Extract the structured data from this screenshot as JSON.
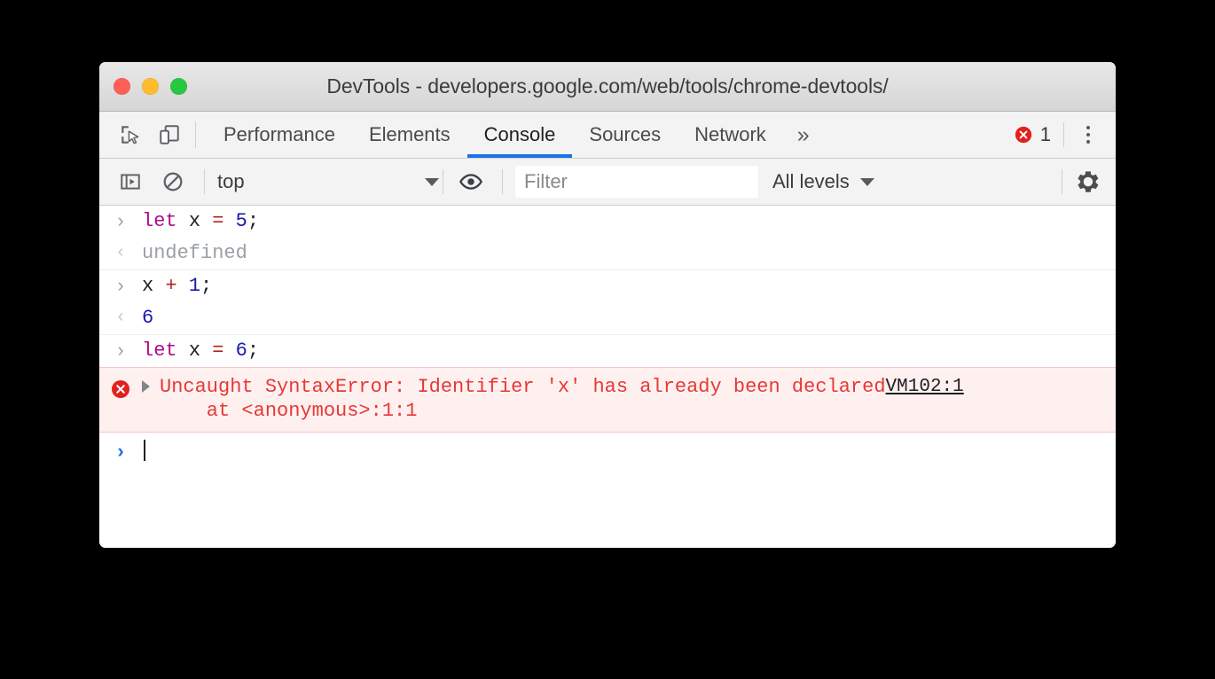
{
  "window": {
    "title": "DevTools - developers.google.com/web/tools/chrome-devtools/",
    "traffic_lights": [
      {
        "name": "close",
        "color": "#ff5f57"
      },
      {
        "name": "minimize",
        "color": "#febc2e"
      },
      {
        "name": "zoom",
        "color": "#28c840"
      }
    ]
  },
  "colors": {
    "accent": "#1a73e8",
    "error_red": "#e53935",
    "error_bg": "#fff0f0",
    "toolbar_bg": "#f3f3f3",
    "keyword": "#aa0d91",
    "number": "#1a1aa6",
    "operator": "#b22222"
  },
  "tabbar": {
    "icons": [
      {
        "name": "inspect-element-icon",
        "label": "Inspect element"
      },
      {
        "name": "device-toolbar-icon",
        "label": "Toggle device toolbar"
      }
    ],
    "tabs": [
      {
        "label": "Performance",
        "active": false
      },
      {
        "label": "Elements",
        "active": false
      },
      {
        "label": "Console",
        "active": true
      },
      {
        "label": "Sources",
        "active": false
      },
      {
        "label": "Network",
        "active": false
      }
    ],
    "overflow_label": "»",
    "error_badge": {
      "icon": "error-circle-icon",
      "count": "1"
    },
    "kebab_label": "Customize and control DevTools"
  },
  "filterbar": {
    "sidebar_toggle": {
      "name": "console-sidebar-icon",
      "label": "Show console sidebar"
    },
    "clear_console": {
      "name": "clear-console-icon",
      "label": "Clear console"
    },
    "context": {
      "value": "top",
      "caret": "▼"
    },
    "eye": {
      "name": "live-expression-icon",
      "label": "Create live expression"
    },
    "filter": {
      "value": "",
      "placeholder": "Filter"
    },
    "levels": {
      "value": "All levels",
      "caret": "▼"
    },
    "settings": {
      "name": "gear-icon",
      "label": "Console settings"
    }
  },
  "console": {
    "prompt_arrow": "›",
    "result_arrow": "‹",
    "entries": [
      {
        "type": "input",
        "tokens": [
          {
            "t": "kw",
            "v": "let"
          },
          {
            "t": "pun",
            "v": " "
          },
          {
            "t": "id",
            "v": "x"
          },
          {
            "t": "pun",
            "v": " "
          },
          {
            "t": "op",
            "v": "="
          },
          {
            "t": "pun",
            "v": " "
          },
          {
            "t": "num",
            "v": "5"
          },
          {
            "t": "pun",
            "v": ";"
          }
        ]
      },
      {
        "type": "result",
        "value": "undefined",
        "style": "undef"
      },
      {
        "type": "input",
        "tokens": [
          {
            "t": "id",
            "v": "x"
          },
          {
            "t": "pun",
            "v": " "
          },
          {
            "t": "op",
            "v": "+"
          },
          {
            "t": "pun",
            "v": " "
          },
          {
            "t": "num",
            "v": "1"
          },
          {
            "t": "pun",
            "v": ";"
          }
        ]
      },
      {
        "type": "result",
        "value": "6",
        "style": "num"
      },
      {
        "type": "input",
        "tokens": [
          {
            "t": "kw",
            "v": "let"
          },
          {
            "t": "pun",
            "v": " "
          },
          {
            "t": "id",
            "v": "x"
          },
          {
            "t": "pun",
            "v": " "
          },
          {
            "t": "op",
            "v": "="
          },
          {
            "t": "pun",
            "v": " "
          },
          {
            "t": "num",
            "v": "6"
          },
          {
            "t": "pun",
            "v": ";"
          }
        ]
      }
    ],
    "error": {
      "icon": "error-circle-icon",
      "message_line1": "Uncaught SyntaxError: Identifier 'x' has already been declared",
      "message_line2": "    at <anonymous>:1:1",
      "source_link": "VM102:1"
    },
    "active_prompt": {
      "arrow": "›",
      "value": ""
    }
  }
}
